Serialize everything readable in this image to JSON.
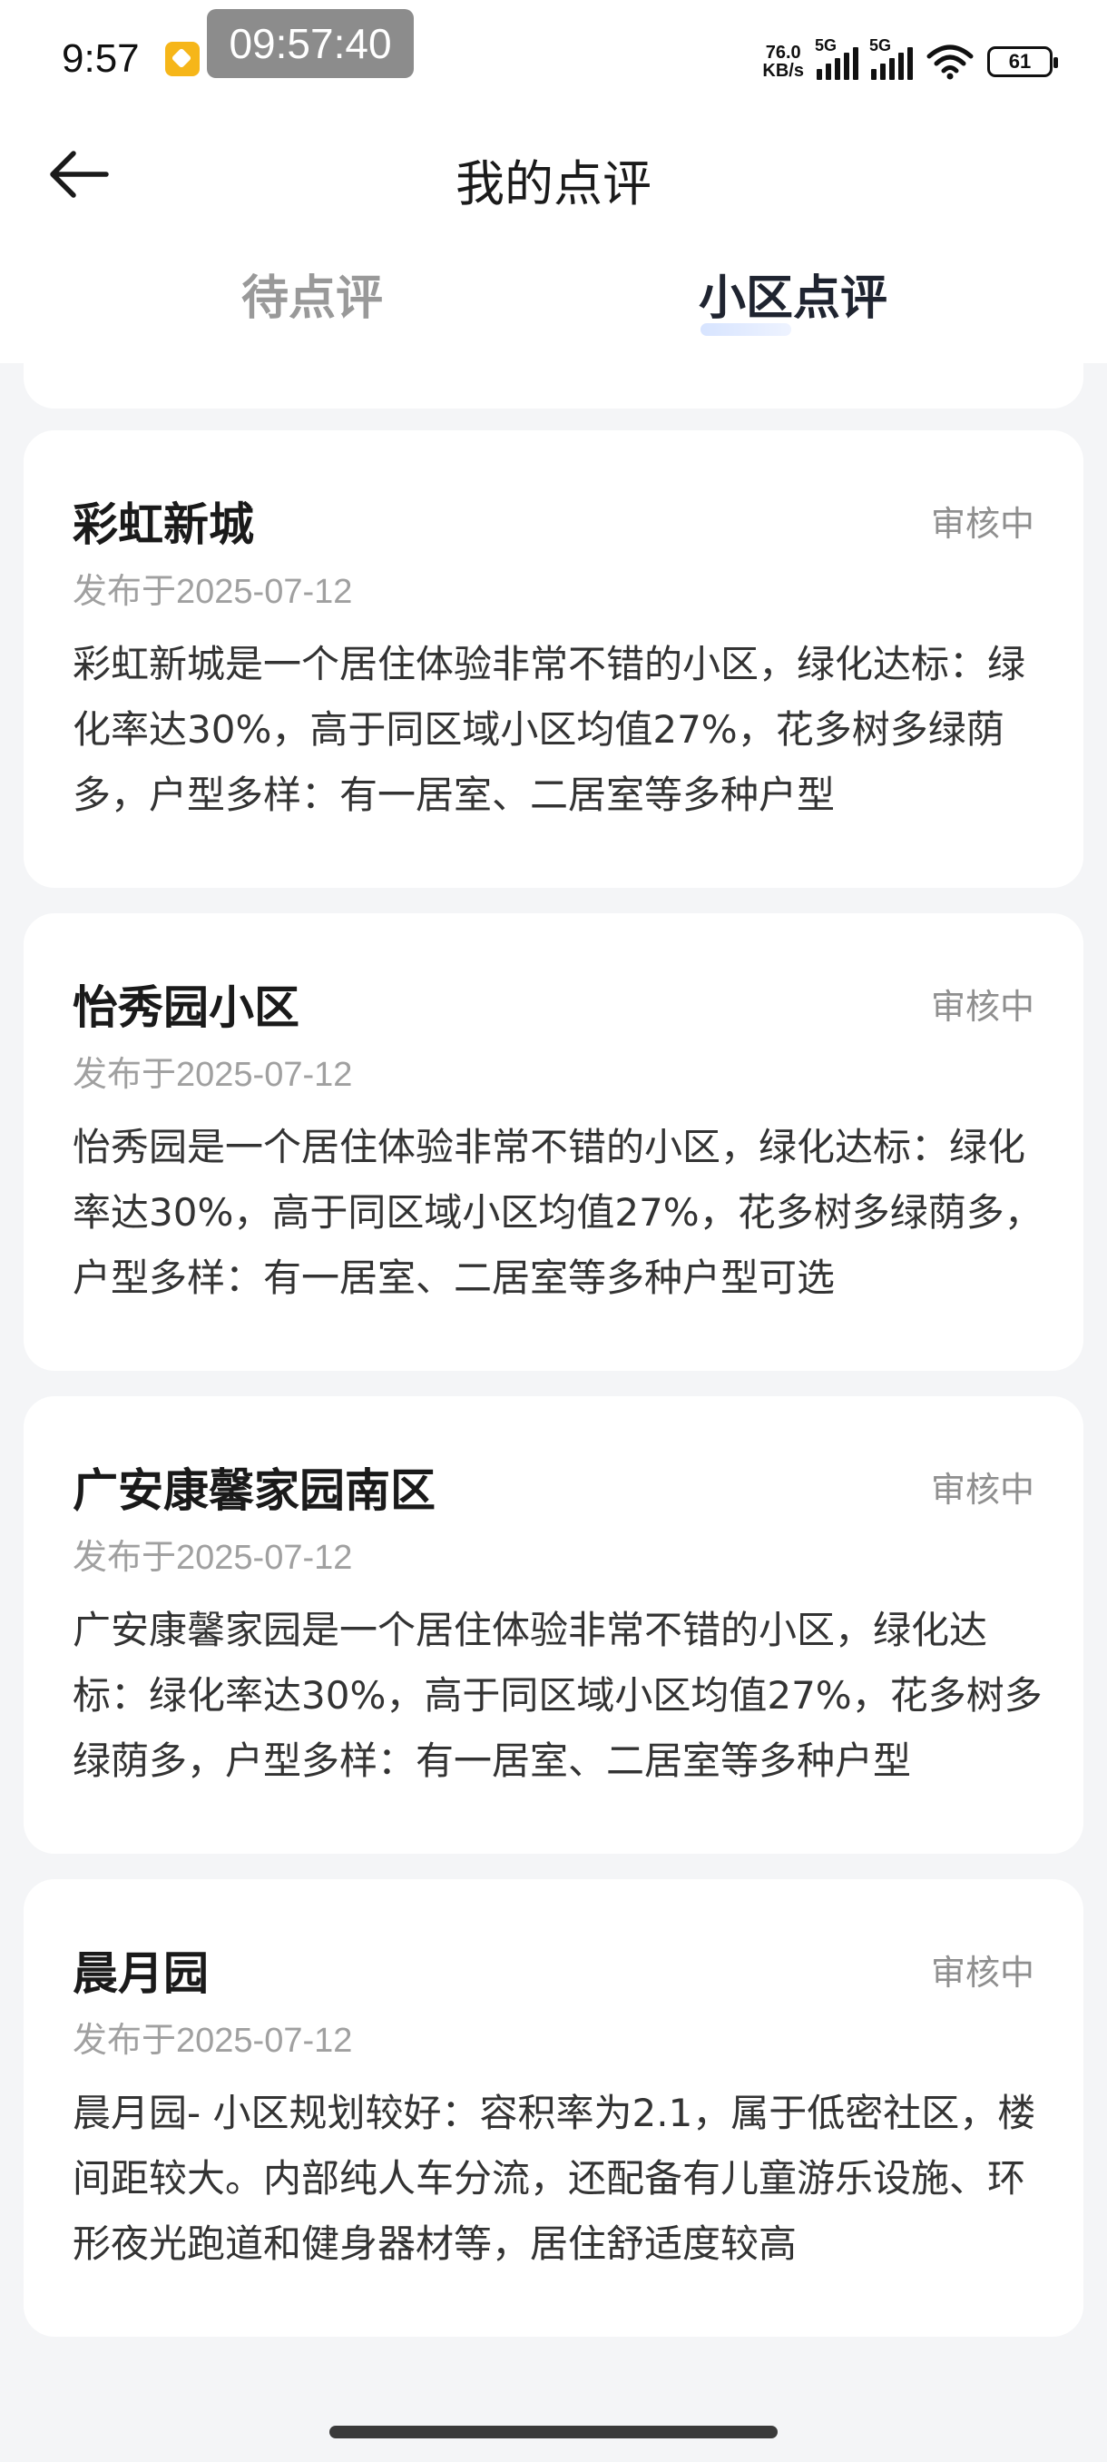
{
  "status_bar": {
    "time": "9:57",
    "clock_overlay": "09:57:40",
    "more": "...",
    "net_speed_value": "76.0",
    "net_speed_unit": "KB/s",
    "signal1_label": "5G",
    "signal2_label": "5G",
    "battery": "61"
  },
  "header": {
    "title": "我的点评"
  },
  "tabs": [
    {
      "label": "待点评"
    },
    {
      "label": "小区点评"
    }
  ],
  "reviews": [
    {
      "title": "彩虹新城",
      "status": "审核中",
      "date": "发布于2025-07-12",
      "content": "彩虹新城是一个居住体验非常不错的小区，绿化达标：绿化率达30%，高于同区域小区均值27%，花多树多绿荫多，户型多样：有一居室、二居室等多种户型"
    },
    {
      "title": "怡秀园小区",
      "status": "审核中",
      "date": "发布于2025-07-12",
      "content": "怡秀园是一个居住体验非常不错的小区，绿化达标：绿化率达30%，高于同区域小区均值27%，花多树多绿荫多，户型多样：有一居室、二居室等多种户型可选"
    },
    {
      "title": "广安康馨家园南区",
      "status": "审核中",
      "date": "发布于2025-07-12",
      "content": "广安康馨家园是一个居住体验非常不错的小区，绿化达标：绿化率达30%，高于同区域小区均值27%，花多树多绿荫多，户型多样：有一居室、二居室等多种户型"
    },
    {
      "title": "晨月园",
      "status": "审核中",
      "date": "发布于2025-07-12",
      "content": "晨月园- 小区规划较好：容积率为2.1，属于低密社区，楼间距较大。内部纯人车分流，还配备有儿童游乐设施、环形夜光跑道和健身器材等，居住舒适度较高"
    }
  ]
}
